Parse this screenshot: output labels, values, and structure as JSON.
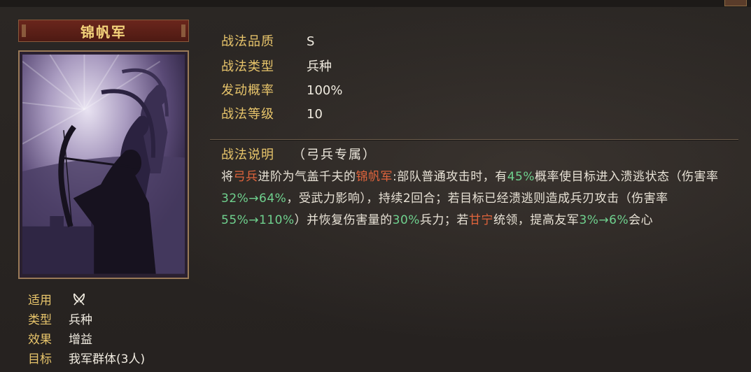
{
  "card": {
    "title": "锦帆军",
    "attributes": [
      {
        "label": "适用",
        "value": "",
        "icon": "crossed-bows-icon"
      },
      {
        "label": "类型",
        "value": "兵种"
      },
      {
        "label": "效果",
        "value": "增益"
      },
      {
        "label": "目标",
        "value": "我军群体(3人)"
      }
    ]
  },
  "info": [
    {
      "label": "战法品质",
      "value": "S"
    },
    {
      "label": "战法类型",
      "value": "兵种"
    },
    {
      "label": "发动概率",
      "value": "100%"
    },
    {
      "label": "战法等级",
      "value": "10"
    }
  ],
  "description": {
    "label": "战法说明",
    "tag": "（弓兵专属）",
    "segments": [
      {
        "t": "将",
        "c": ""
      },
      {
        "t": "弓兵",
        "c": "red"
      },
      {
        "t": "进阶为气盖千夫的",
        "c": ""
      },
      {
        "t": "锦帆军",
        "c": "red"
      },
      {
        "t": ":部队普通攻击时，有",
        "c": ""
      },
      {
        "t": "45%",
        "c": "green"
      },
      {
        "t": "概率使目标进入溃逃状态（伤害率",
        "c": ""
      },
      {
        "t": "32%→64%",
        "c": "green"
      },
      {
        "t": "，受武力影响），持续2回合；若目标已经溃逃则造成兵刃攻击（伤害率",
        "c": ""
      },
      {
        "t": "55%→110%",
        "c": "green"
      },
      {
        "t": "）并恢复伤害量的",
        "c": ""
      },
      {
        "t": "30%",
        "c": "green"
      },
      {
        "t": "兵力；若",
        "c": ""
      },
      {
        "t": "甘宁",
        "c": "red"
      },
      {
        "t": "统领，提高友军",
        "c": ""
      },
      {
        "t": "3%→6%",
        "c": "green"
      },
      {
        "t": "会心",
        "c": ""
      }
    ]
  },
  "colors": {
    "label_gold": "#e8c56b",
    "highlight_red": "#e0643c",
    "highlight_green": "#6fd18e",
    "title_banner": "#6a261c"
  }
}
